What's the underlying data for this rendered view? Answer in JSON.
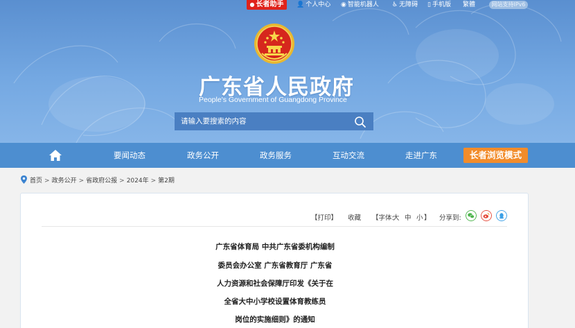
{
  "topbar": {
    "elder_label": "长者助手",
    "links": [
      {
        "label": "个人中心",
        "icon": "person-icon"
      },
      {
        "label": "智能机器人",
        "icon": "robot-icon"
      },
      {
        "label": "无障碍",
        "icon": "accessibility-icon"
      },
      {
        "label": "手机版",
        "icon": "mobile-icon"
      },
      {
        "label": "繁體",
        "icon": ""
      }
    ],
    "ipv6_label": "网站支持IPv6"
  },
  "header": {
    "title": "广东省人民政府",
    "subtitle": "People's Government of Guangdong Province",
    "search_placeholder": "请输入要搜索的内容"
  },
  "nav": {
    "items": [
      "要闻动态",
      "政务公开",
      "政务服务",
      "互动交流",
      "走进广东"
    ],
    "elder_mode_label": "长者浏览模式"
  },
  "breadcrumb": [
    "首页",
    "政务公开",
    "省政府公报",
    "2024年",
    "第2期"
  ],
  "tools": {
    "print": "【打印】",
    "favorite": "收藏",
    "font_prefix": "【字体:",
    "font_large": "大",
    "font_medium": "中",
    "font_small": "小",
    "font_suffix": "】",
    "share_label": "分享到:"
  },
  "document": {
    "title_lines": [
      "广东省体育局 中共广东省委机构编制",
      "委员会办公室 广东省教育厅 广东省",
      "人力资源和社会保障厅印发《关于在",
      "全省大中小学校设置体育教练员",
      "岗位的实施细则》的通知"
    ]
  },
  "colors": {
    "hero": "#74a8e2",
    "nav": "#4d8ed0",
    "elder_red": "#e0231b",
    "elder_orange": "#f28c2b",
    "wechat": "#4bb34a",
    "weibo": "#e44a3a",
    "qq": "#3a9fe6"
  }
}
